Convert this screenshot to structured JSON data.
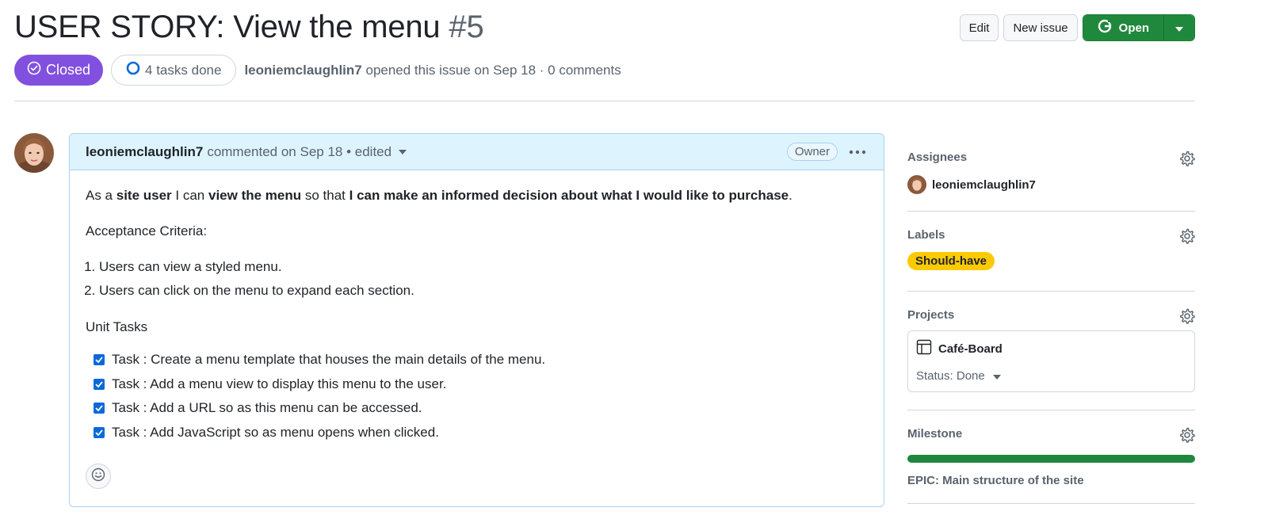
{
  "issue": {
    "title": "USER STORY: View the menu",
    "number": "#5",
    "state": "Closed",
    "tasks_done": "4 tasks done",
    "author": "leoniemclaughlin7",
    "opened_text": "opened this issue on Sep 18 · 0 comments"
  },
  "actions": {
    "edit_label": "Edit",
    "new_issue_label": "New issue",
    "open_label": "Open"
  },
  "comment": {
    "author": "leoniemclaughlin7",
    "meta": "commented on Sep 18 • edited",
    "role_badge": "Owner",
    "intro": {
      "p1": "As a ",
      "b1": "site user",
      "p2": " I can ",
      "b2": "view the menu",
      "p3": " so that ",
      "b3": "I can make an informed decision about what I would like to purchase",
      "p4": "."
    },
    "acceptance_heading": "Acceptance Criteria:",
    "criteria": [
      "Users can view a styled menu.",
      "Users can click on the menu to expand each section."
    ],
    "unit_tasks_heading": "Unit Tasks",
    "tasks": [
      {
        "label": "Task : Create a menu template that houses the main details of the menu.",
        "checked": true
      },
      {
        "label": "Task : Add a menu view to display this menu to the user.",
        "checked": true
      },
      {
        "label": "Task : Add a URL so as this menu can be accessed.",
        "checked": true
      },
      {
        "label": "Task : Add JavaScript so as menu opens when clicked.",
        "checked": true
      }
    ]
  },
  "sidebar": {
    "assignees": {
      "heading": "Assignees",
      "user": "leoniemclaughlin7"
    },
    "labels": {
      "heading": "Labels",
      "label": "Should-have",
      "label_color": "#fbca04"
    },
    "projects": {
      "heading": "Projects",
      "project_name": "Café-Board",
      "status": "Status: Done"
    },
    "milestone": {
      "heading": "Milestone",
      "title": "EPIC: Main structure of the site",
      "progress": 1.0
    }
  },
  "colors": {
    "closed_purple": "#8250df",
    "open_green": "#1f883d",
    "comment_header_bg": "#ddf4ff",
    "checkbox_blue": "#0969da"
  },
  "icons": [
    "check-circle-icon",
    "progress-circle-icon",
    "chevron-down-icon",
    "kebab-icon",
    "smiley-icon",
    "gear-icon",
    "table-icon",
    "open-issue-icon"
  ]
}
